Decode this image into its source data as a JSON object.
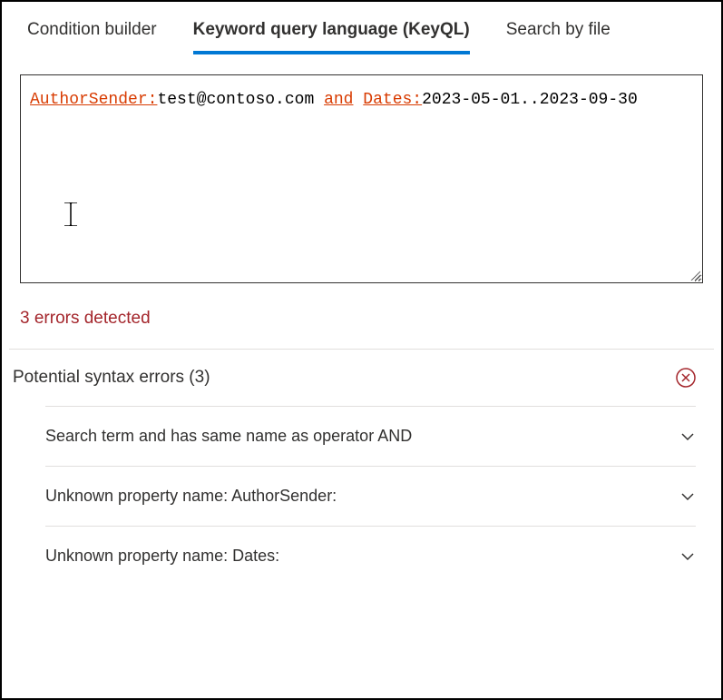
{
  "tabs": {
    "items": [
      {
        "label": "Condition builder",
        "active": false
      },
      {
        "label": "Keyword query language (KeyQL)",
        "active": true
      },
      {
        "label": "Search by file",
        "active": false
      }
    ]
  },
  "query": {
    "segments": [
      {
        "text": "AuthorSender:",
        "class": "syntax-error"
      },
      {
        "text": "test@contoso.com ",
        "class": "syntax-normal"
      },
      {
        "text": "and",
        "class": "syntax-error"
      },
      {
        "text": " ",
        "class": "syntax-normal"
      },
      {
        "text": "Dates:",
        "class": "syntax-error"
      },
      {
        "text": "2023-05-01..2023-09-30",
        "class": "syntax-normal"
      }
    ]
  },
  "errors": {
    "summary": "3 errors detected",
    "section_title": "Potential syntax errors (3)",
    "items": [
      "Search term and has same name as operator AND",
      "Unknown property name: AuthorSender:",
      "Unknown property name: Dates:"
    ]
  }
}
